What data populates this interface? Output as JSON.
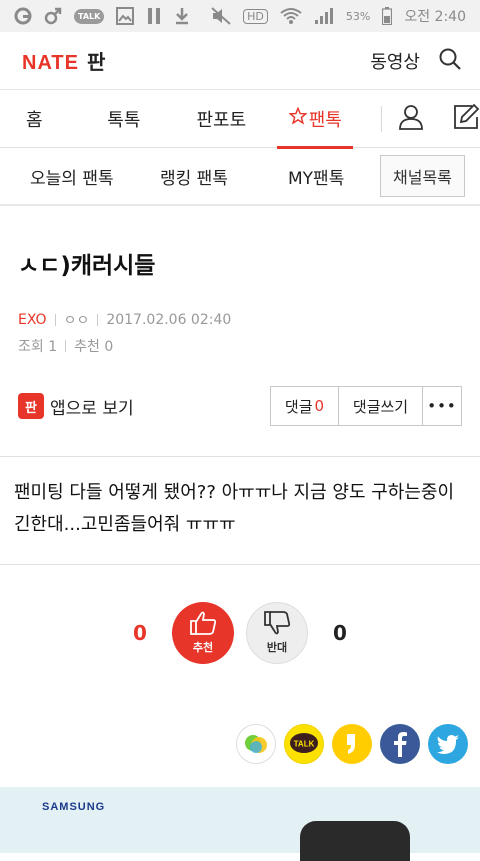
{
  "status_bar": {
    "battery": "53%",
    "time": "오전 2:40",
    "talk_badge": "TALK",
    "hd_label": "HD"
  },
  "app_bar": {
    "logo_brand": "NATE",
    "logo_section": "판",
    "video_link": "동영상",
    "brand_color": "#e8352a"
  },
  "main_nav": {
    "tabs": [
      "홈",
      "톡톡",
      "판포토",
      "팬톡"
    ],
    "active_tab": "팬톡"
  },
  "sub_nav": {
    "items": [
      "오늘의 팬톡",
      "랭킹 팬톡",
      "MY팬톡"
    ],
    "channel_button": "채널목록"
  },
  "article": {
    "title": "ㅅㄷ)캐러시들",
    "category": "EXO",
    "author": "ㅇㅇ",
    "datetime": "2017.02.06 02:40",
    "views_label": "조회",
    "views": "1",
    "recommend_label": "추천",
    "recommend_count": "0",
    "app_view_label": "앱으로 보기",
    "app_badge": "판",
    "comment_button": "댓글",
    "comment_count": "0",
    "write_comment_button": "댓글쓰기",
    "more_button": "•••",
    "body_lines": [
      "팬미팅 다들 어떻게 됐어?? 아ㅠㅠ나 지금 양도 구하는중이",
      "긴한대...고민좀들어줘 ㅠㅠㅠ"
    ]
  },
  "vote": {
    "up_count": "0",
    "up_label": "추천",
    "down_label": "반대",
    "down_count": "0"
  },
  "share": {
    "kakaotalk_label": "TALK",
    "icons": [
      "band-icon",
      "kakaotalk-icon",
      "kakaostory-icon",
      "facebook-icon",
      "twitter-icon"
    ]
  },
  "ad": {
    "brand": "SAMSUNG"
  }
}
